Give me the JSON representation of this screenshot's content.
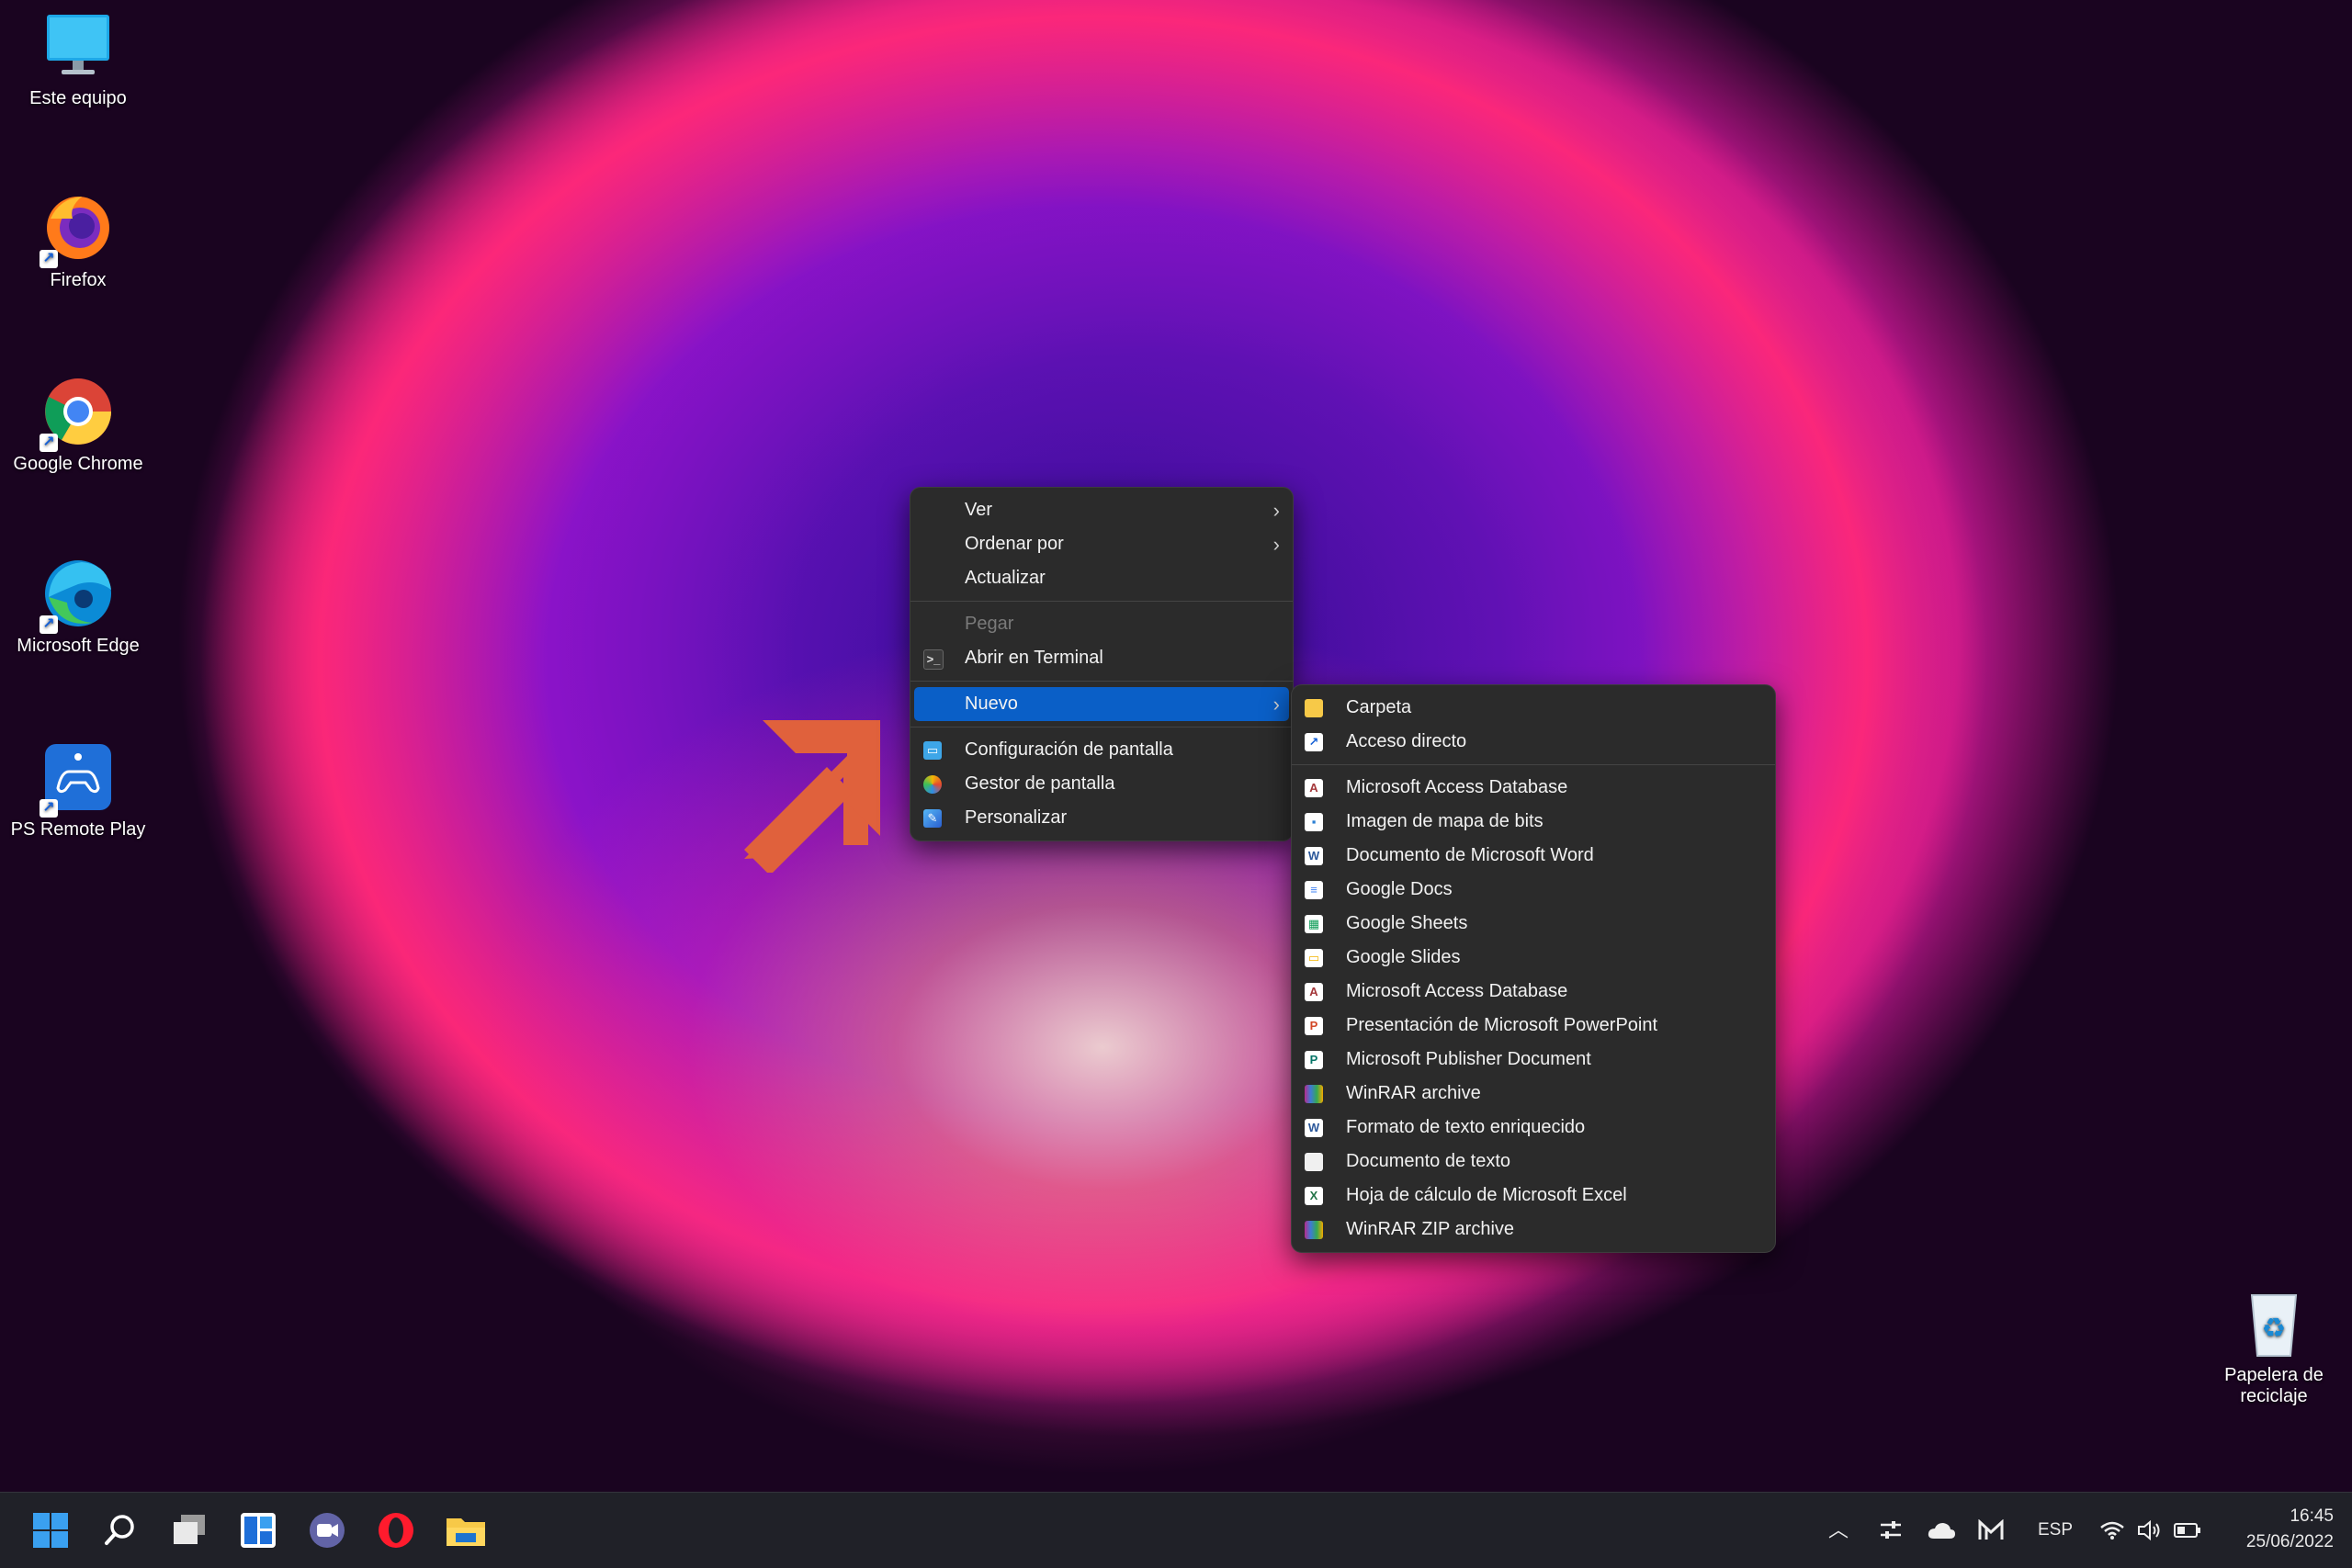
{
  "desktop_icons": [
    {
      "label": "Este equipo",
      "icon": "monitor-icon"
    },
    {
      "label": "Firefox",
      "icon": "firefox-icon"
    },
    {
      "label": "Google Chrome",
      "icon": "chrome-icon"
    },
    {
      "label": "Microsoft Edge",
      "icon": "edge-icon"
    },
    {
      "label": "PS Remote Play",
      "icon": "ps-remote-play-icon"
    },
    {
      "label": "Papelera de reciclaje",
      "icon": "recycle-bin-icon"
    }
  ],
  "context_menu": {
    "items": [
      {
        "label": "Ver"
      },
      {
        "label": "Ordenar por"
      },
      {
        "label": "Actualizar"
      },
      {
        "label": "Pegar"
      },
      {
        "label": "Abrir en Terminal"
      },
      {
        "label": "Nuevo"
      },
      {
        "label": "Configuración de pantalla"
      },
      {
        "label": "Gestor de pantalla"
      },
      {
        "label": "Personalizar"
      }
    ],
    "submenu_chevron": "›"
  },
  "submenu_nuevo": {
    "items": [
      {
        "label": "Carpeta"
      },
      {
        "label": "Acceso directo"
      },
      {
        "label": "Microsoft Access Database"
      },
      {
        "label": "Imagen de mapa de bits"
      },
      {
        "label": "Documento de Microsoft Word"
      },
      {
        "label": "Google Docs"
      },
      {
        "label": "Google Sheets"
      },
      {
        "label": "Google Slides"
      },
      {
        "label": "Microsoft Access Database"
      },
      {
        "label": "Presentación de Microsoft PowerPoint"
      },
      {
        "label": "Microsoft Publisher Document"
      },
      {
        "label": "WinRAR archive"
      },
      {
        "label": "Formato de texto enriquecido"
      },
      {
        "label": "Documento de texto"
      },
      {
        "label": "Hoja de cálculo de Microsoft Excel"
      },
      {
        "label": "WinRAR ZIP archive"
      }
    ]
  },
  "taskbar": {
    "pinned": [
      "start-icon",
      "search-icon",
      "task-view-icon",
      "widgets-icon",
      "teams-chat-icon",
      "opera-icon",
      "file-explorer-icon"
    ],
    "tray": {
      "language": "ESP",
      "time": "16:45",
      "date": "25/06/2022"
    }
  },
  "colors": {
    "menu_bg": "#2b2b2b",
    "highlight": "#0a5fc7",
    "arrow": "#e0613c",
    "taskbar_bg": "#202128"
  }
}
